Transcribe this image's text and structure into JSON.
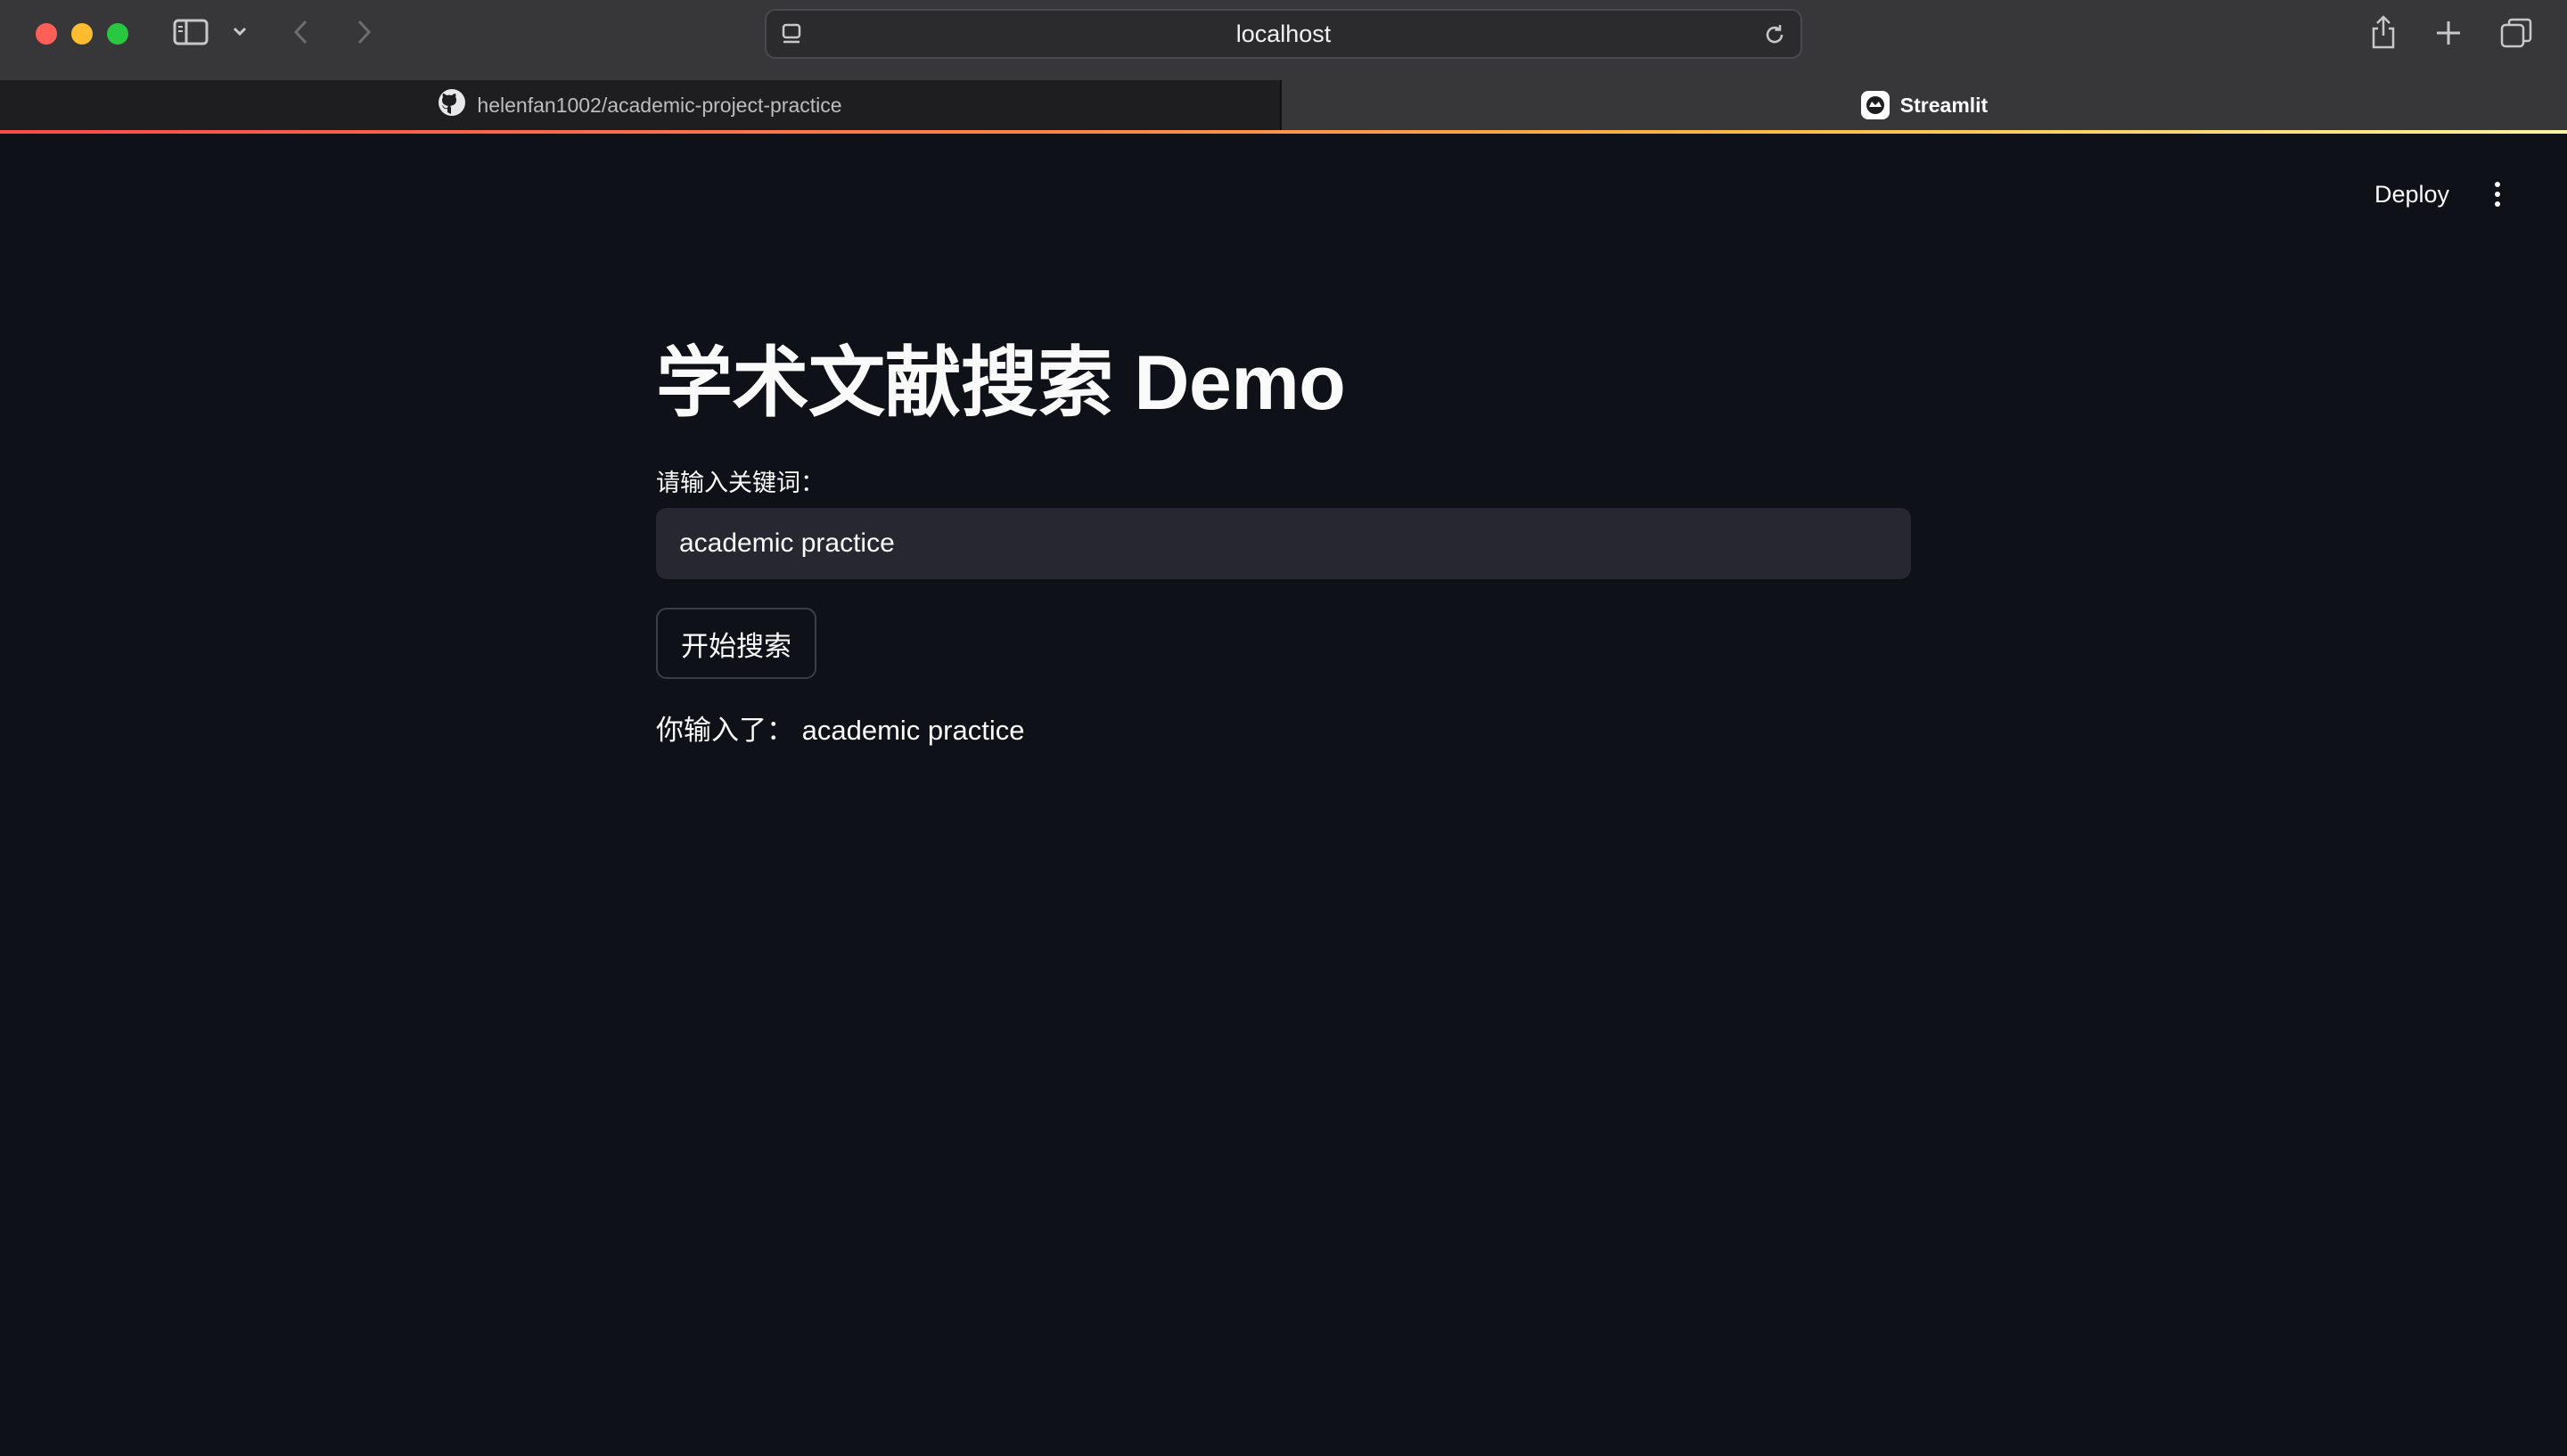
{
  "browser": {
    "url": "localhost",
    "tabs": [
      {
        "label": "helenfan1002/academic-project-practice",
        "icon": "github-icon",
        "active": false
      },
      {
        "label": "Streamlit",
        "icon": "streamlit-icon",
        "active": true
      }
    ]
  },
  "app_header": {
    "deploy_label": "Deploy",
    "menu_icon": "kebab-menu-icon"
  },
  "main": {
    "title": "学术文献搜索 Demo",
    "input_label": "请输入关键词：",
    "input_value": "academic practice",
    "button_label": "开始搜索",
    "result_text": "你输入了： academic practice"
  },
  "colors": {
    "background": "#0e1117",
    "input_bg": "#262730",
    "text": "#fafafa",
    "accent": "#ff4b4b"
  }
}
